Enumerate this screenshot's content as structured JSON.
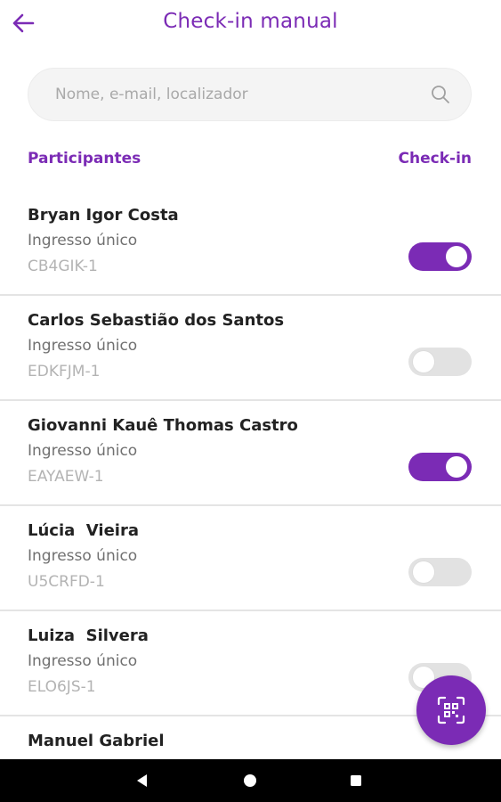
{
  "header": {
    "title": "Check-in manual"
  },
  "search": {
    "placeholder": "Nome, e-mail, localizador",
    "value": ""
  },
  "columns": {
    "left": "Participantes",
    "right": "Check-in"
  },
  "participants": [
    {
      "name": "Bryan Igor Costa",
      "ticket": "Ingresso único",
      "code": "CB4GIK-1",
      "checked_in": true
    },
    {
      "name": "Carlos Sebastião dos Santos",
      "ticket": "Ingresso único",
      "code": "EDKFJM-1",
      "checked_in": false
    },
    {
      "name": "Giovanni Kauê Thomas Castro",
      "ticket": "Ingresso único",
      "code": "EAYAEW-1",
      "checked_in": true
    },
    {
      "name": "Lúcia  Vieira",
      "ticket": "Ingresso único",
      "code": "U5CRFD-1",
      "checked_in": false
    },
    {
      "name": "Luiza  Silvera",
      "ticket": "Ingresso único",
      "code": "ELO6JS-1",
      "checked_in": false
    },
    {
      "name": "Manuel Gabriel",
      "ticket": "",
      "code": "",
      "checked_in": false
    }
  ],
  "colors": {
    "accent": "#7b2bb5",
    "toggle_off": "#e2e2e2",
    "nav_bar": "#000000"
  },
  "icons": {
    "back": "arrow-left-icon",
    "search": "search-icon",
    "fab": "qr-scan-icon",
    "nav_back": "triangle-back-icon",
    "nav_home": "circle-home-icon",
    "nav_recents": "square-recents-icon"
  }
}
